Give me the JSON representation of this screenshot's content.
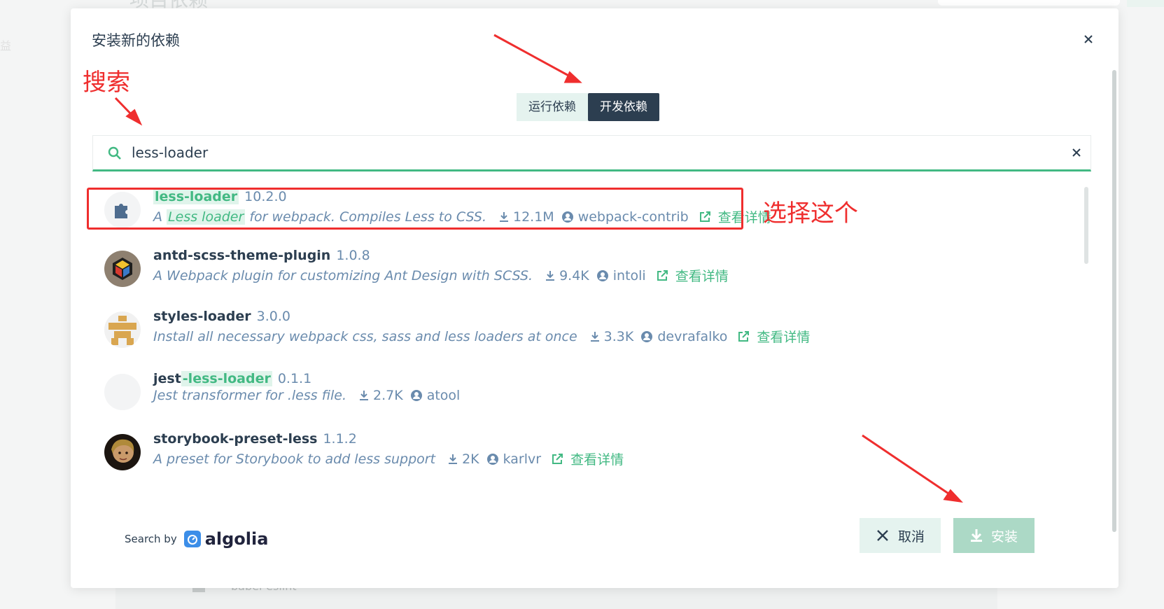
{
  "background": {
    "title": "项目依赖",
    "side_text": "益",
    "row_label": "babel-eslint"
  },
  "dialog": {
    "title": "安装新的依赖",
    "close_icon": "close-icon"
  },
  "tabs": [
    {
      "label": "运行依赖",
      "active": false
    },
    {
      "label": "开发依赖",
      "active": true
    }
  ],
  "search": {
    "value": "less-loader",
    "placeholder": "",
    "icon": "search-icon",
    "clear_icon": "close-icon"
  },
  "packages": [
    {
      "name_highlight": "less-loader",
      "version": "10.2.0",
      "desc_prefix": "A ",
      "desc_highlight": "Less loader",
      "desc_suffix": " for webpack. Compiles Less to CSS.",
      "downloads": "12.1M",
      "author": "webpack-contrib",
      "details": "查看详情",
      "avatar": "puzzle-icon"
    },
    {
      "name": "antd-scss-theme-plugin",
      "version": "1.0.8",
      "desc": "A Webpack plugin for customizing Ant Design with SCSS.",
      "downloads": "9.4K",
      "author": "intoli",
      "details": "查看详情",
      "avatar": "cube-logo-icon"
    },
    {
      "name": "styles-loader",
      "version": "3.0.0",
      "desc": "Install all necessary webpack css, sass and less loaders at once",
      "downloads": "3.3K",
      "author": "devrafalko",
      "details": "查看详情",
      "avatar": "pixel-avatar-icon"
    },
    {
      "name_prefix": "jest",
      "name_highlight": "-less-loader",
      "version": "0.1.1",
      "desc": "Jest transformer for .less file.",
      "downloads": "2.7K",
      "author": "atool",
      "avatar": "blank-avatar"
    },
    {
      "name": "storybook-preset-less",
      "version": "1.1.2",
      "desc": "A preset for Storybook to add less support",
      "downloads": "2K",
      "author": "karlvr",
      "details": "查看详情",
      "avatar": "photo-avatar"
    }
  ],
  "footer": {
    "search_by": "Search by",
    "algolia": "algolia",
    "cancel_label": "取消",
    "install_label": "安装"
  },
  "annotations": {
    "search_note": "搜索",
    "select_note": "选择这个"
  },
  "colors": {
    "accent": "#42b983",
    "dark": "#2c3e50",
    "muted": "#6a8bad",
    "annotation_red": "#ef2e2e",
    "tab_light": "#e5f3ef"
  }
}
